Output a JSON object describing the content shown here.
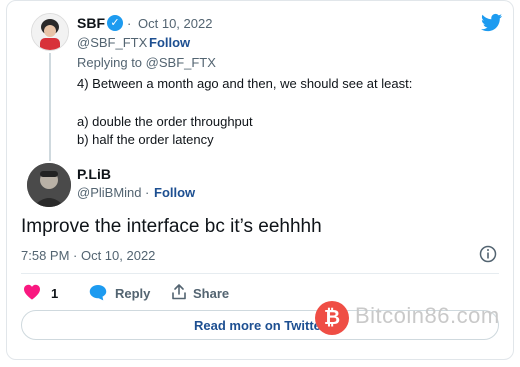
{
  "original": {
    "author_name": "SBF",
    "separator": "·",
    "date": "Oct 10, 2022",
    "handle": "@SBF_FTX",
    "follow_label": "Follow",
    "replying_to": "Replying to @SBF_FTX",
    "lines": [
      "4) Between a month ago and then, we should see at least:",
      "a) double the order throughput",
      "b) half the order latency"
    ]
  },
  "reply": {
    "author_name": "P.LiB",
    "handle": "@PliBMind",
    "separator": "·",
    "follow_label": "Follow",
    "text": "Improve the interface bc it’s eehhhh",
    "timestamp": "7:58 PM · Oct 10, 2022",
    "likes": "1",
    "reply_label": "Reply",
    "share_label": "Share"
  },
  "read_more_label": "Read more on Twitter",
  "watermark": {
    "brand": "Bitcoin86.com",
    "badge": "₿"
  },
  "colors": {
    "accent": "#1d9bf0",
    "heart": "#f91880",
    "watermark_red": "#ef4e45"
  },
  "icons": [
    "twitter-bird-icon",
    "verified-badge-icon",
    "info-icon",
    "heart-icon",
    "reply-bubble-icon",
    "share-icon"
  ]
}
